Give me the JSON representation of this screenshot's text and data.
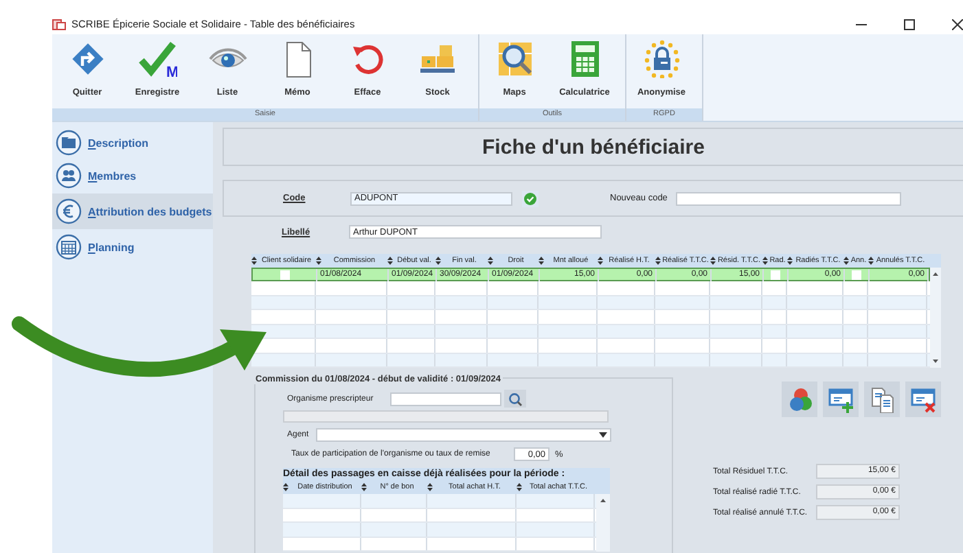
{
  "window": {
    "title": "SCRIBE Épicerie Sociale et Solidaire - Table des bénéficiaires"
  },
  "ribbon": {
    "groups": [
      {
        "label": "Saisie",
        "buttons": [
          {
            "label": "Quitter",
            "kind": "exit"
          },
          {
            "label": "Enregistre",
            "kind": "save",
            "icon_letter": "M"
          },
          {
            "label": "Liste",
            "kind": "eye"
          },
          {
            "label": "Mémo",
            "kind": "page"
          },
          {
            "label": "Efface",
            "kind": "undo"
          },
          {
            "label": "Stock",
            "kind": "boxes"
          }
        ]
      },
      {
        "label": "Outils",
        "buttons": [
          {
            "label": "Maps",
            "kind": "map"
          },
          {
            "label": "Calculatrice",
            "kind": "calc"
          }
        ]
      },
      {
        "label": "RGPD",
        "buttons": [
          {
            "label": "Anonymise",
            "kind": "lock"
          }
        ]
      }
    ]
  },
  "sidebar": {
    "items": [
      {
        "label": "Description",
        "kind": "folder",
        "selected": false
      },
      {
        "label": "Membres",
        "kind": "people",
        "selected": false
      },
      {
        "label": "Attribution des budgets",
        "kind": "euro",
        "selected": true
      },
      {
        "label": "Planning",
        "kind": "calendar",
        "selected": false
      }
    ]
  },
  "page_title": "Fiche d'un bénéficiaire",
  "identity": {
    "code": {
      "label": "Code",
      "value": "ADUPONT",
      "valid": true
    },
    "new_code": {
      "label": "Nouveau code"
    },
    "libelle": {
      "label": "Libellé",
      "value": "Arthur DUPONT"
    }
  },
  "budgets_table": {
    "columns": [
      {
        "label": "Client solidaire"
      },
      {
        "label": "Commission"
      },
      {
        "label": "Début val."
      },
      {
        "label": "Fin val."
      },
      {
        "label": "Droit"
      },
      {
        "label": "Mnt alloué"
      },
      {
        "label": "Réalisé H.T."
      },
      {
        "label": "Réalisé T.T.C."
      },
      {
        "label": "Résid. T.T.C."
      },
      {
        "label": "Rad."
      },
      {
        "label": "Radiés T.T.C."
      },
      {
        "label": "Ann."
      },
      {
        "label": "Annulés T.T.C."
      }
    ],
    "rows": [
      {
        "selected": true,
        "cells": [
          {
            "kind": "checkbox",
            "checked": false
          },
          {
            "kind": "text",
            "text": "01/08/2024"
          },
          {
            "kind": "text",
            "text": "01/09/2024"
          },
          {
            "kind": "text",
            "text": "30/09/2024"
          },
          {
            "kind": "text",
            "text": "01/09/2024"
          },
          {
            "kind": "number",
            "text": "15,00"
          },
          {
            "kind": "number",
            "text": "0,00"
          },
          {
            "kind": "number",
            "text": "0,00"
          },
          {
            "kind": "number",
            "text": "15,00"
          },
          {
            "kind": "checkbox",
            "checked": false
          },
          {
            "kind": "number",
            "text": "0,00"
          },
          {
            "kind": "checkbox",
            "checked": false
          },
          {
            "kind": "number",
            "text": "0,00"
          }
        ]
      }
    ]
  },
  "commission": {
    "title": "Commission du 01/08/2024 - début de validité : 01/09/2024",
    "organisme": {
      "label": "Organisme prescripteur"
    },
    "agent": {
      "label": "Agent"
    },
    "taux": {
      "label": "Taux de participation de l'organisme ou taux de remise",
      "value": "0,00",
      "unit": "%"
    },
    "passages": {
      "title": "Détail des passages en caisse déjà réalisées pour la période :",
      "columns": [
        {
          "label": "Date distribution"
        },
        {
          "label": "N° de bon"
        },
        {
          "label": "Total achat H.T."
        },
        {
          "label": "Total achat T.T.C."
        }
      ]
    }
  },
  "actions": [
    {
      "kind": "circles"
    },
    {
      "kind": "add"
    },
    {
      "kind": "copy"
    },
    {
      "kind": "delete"
    }
  ],
  "totals": [
    {
      "label": "Total Résiduel T.T.C.",
      "value": "15,00 €"
    },
    {
      "label": "Total réalisé radié T.T.C.",
      "value": "0,00 €"
    },
    {
      "label": "Total réalisé annulé T.T.C.",
      "value": "0,00 €"
    }
  ]
}
